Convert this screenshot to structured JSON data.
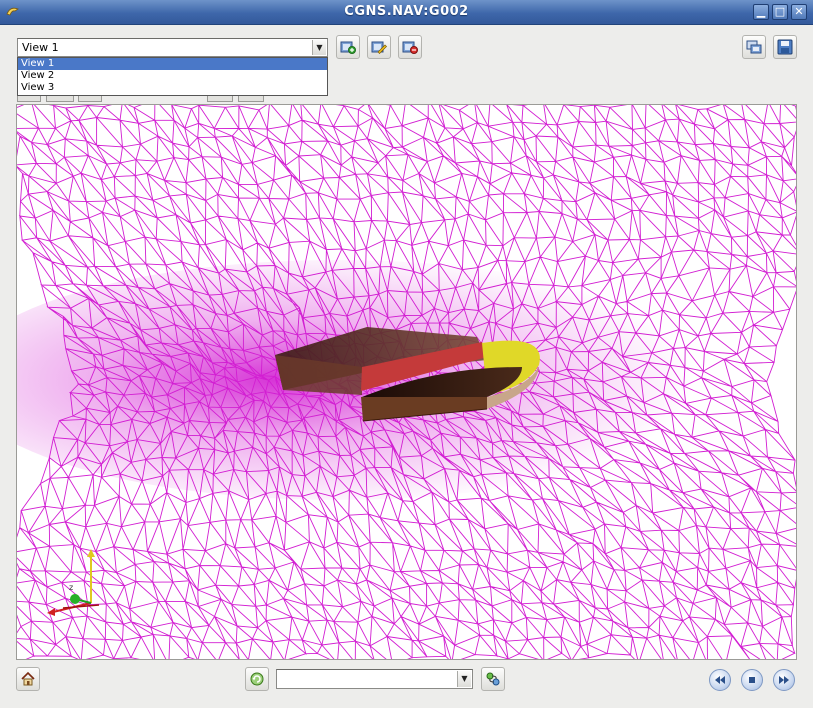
{
  "window": {
    "title": "CGNS.NAV:G002"
  },
  "view_selector": {
    "selected": "View 1",
    "options": [
      "View 1",
      "View 2",
      "View 3"
    ],
    "highlighted_index": 0
  },
  "toolbar": {
    "left_buttons": [
      "add-view-icon",
      "edit-view-icon",
      "delete-view-icon"
    ],
    "right_buttons": [
      "snapshot-icon",
      "save-icon"
    ]
  },
  "bottom_bar": {
    "buttons": [
      "home-icon",
      "refresh-icon",
      "family-icon",
      "previous-icon",
      "stop-icon",
      "next-icon"
    ],
    "family_selector": {
      "selected": ""
    }
  },
  "colors": {
    "mesh": "#d21ed2",
    "title_bar": "#4a72b4",
    "surface_dark": "#5a3018",
    "surface_red": "#c43a3a",
    "surface_yellow": "#e0d828",
    "surface_tan": "#c8a68a"
  }
}
